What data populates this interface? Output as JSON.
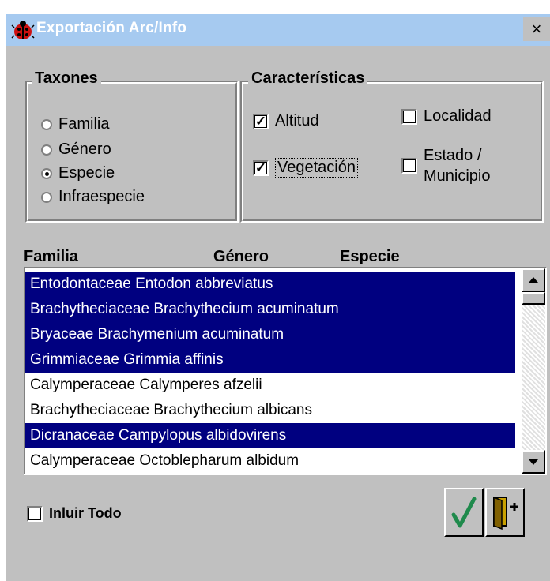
{
  "window": {
    "title": "Exportación Arc/Info",
    "close_label": "×"
  },
  "taxones": {
    "legend": "Taxones",
    "options": [
      {
        "label": "Familia",
        "selected": false
      },
      {
        "label": "Género",
        "selected": false
      },
      {
        "label": "Especie",
        "selected": true
      },
      {
        "label": "Infraespecie",
        "selected": false
      }
    ]
  },
  "caracteristicas": {
    "legend": "Características",
    "altitud": {
      "label": "Altitud",
      "checked": true
    },
    "vegetacion": {
      "label": "Vegetación",
      "checked": true
    },
    "localidad": {
      "label": "Localidad",
      "checked": false
    },
    "estado": {
      "label_line1": "Estado /",
      "label_line2": "Municipio",
      "checked": false
    }
  },
  "list": {
    "headers": [
      "Familia",
      "Género",
      "Especie"
    ],
    "items": [
      {
        "text": "Entodontaceae Entodon abbreviatus",
        "selected": true
      },
      {
        "text": "Brachytheciaceae Brachythecium acuminatum",
        "selected": true
      },
      {
        "text": "Bryaceae Brachymenium acuminatum",
        "selected": true
      },
      {
        "text": "Grimmiaceae Grimmia affinis",
        "selected": true
      },
      {
        "text": "Calymperaceae Calymperes afzelii",
        "selected": false
      },
      {
        "text": "Brachytheciaceae Brachythecium albicans",
        "selected": false
      },
      {
        "text": "Dicranaceae Campylopus albidovirens",
        "selected": true
      },
      {
        "text": "Calymperaceae Octoblepharum albidum",
        "selected": false
      }
    ]
  },
  "incluir": {
    "label": "Inluir Todo",
    "checked": false
  },
  "icons": {
    "ok": "checkmark-icon",
    "exit": "exit-door-icon",
    "app": "ladybug-icon"
  },
  "colors": {
    "selection": "#000080",
    "titlebar": "#a6caf0",
    "window": "#c0c0c0",
    "check": "#1f8a4c"
  }
}
